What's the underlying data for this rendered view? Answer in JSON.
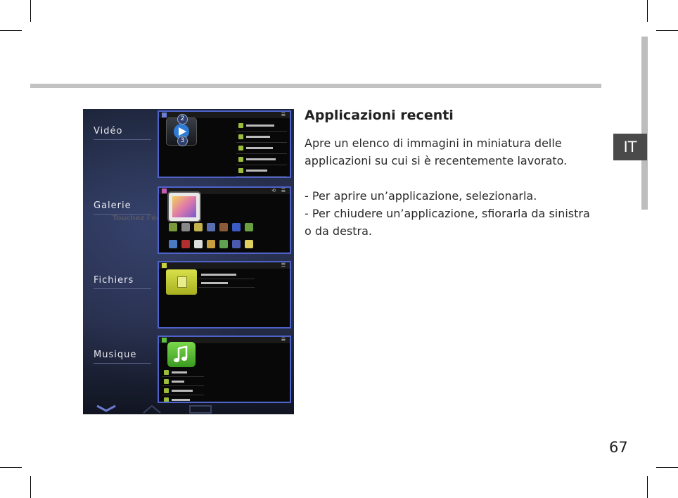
{
  "page": {
    "lang_tab": "IT",
    "page_number": "67"
  },
  "article": {
    "heading": "Applicazioni recenti",
    "intro": "Apre un elenco di immagini in miniatura delle applicazioni su cui si è recentemente lavorato.",
    "step_open": "- Per aprire un’applicazione, selezionarla.",
    "step_close": "- Per chiudere un’applicazione, sfiorarla da sinistra o da destra."
  },
  "screenshot": {
    "menu": [
      "Vidéo",
      "Galerie",
      "Fichiers",
      "Musique"
    ],
    "ghost_text": "Touchez l'éc",
    "video_badges": [
      "2",
      "3"
    ]
  },
  "colors": {
    "card_border": "#4f62c9",
    "lang_tab_bg": "#4a4a4a",
    "rule": "#c2c2c2"
  }
}
